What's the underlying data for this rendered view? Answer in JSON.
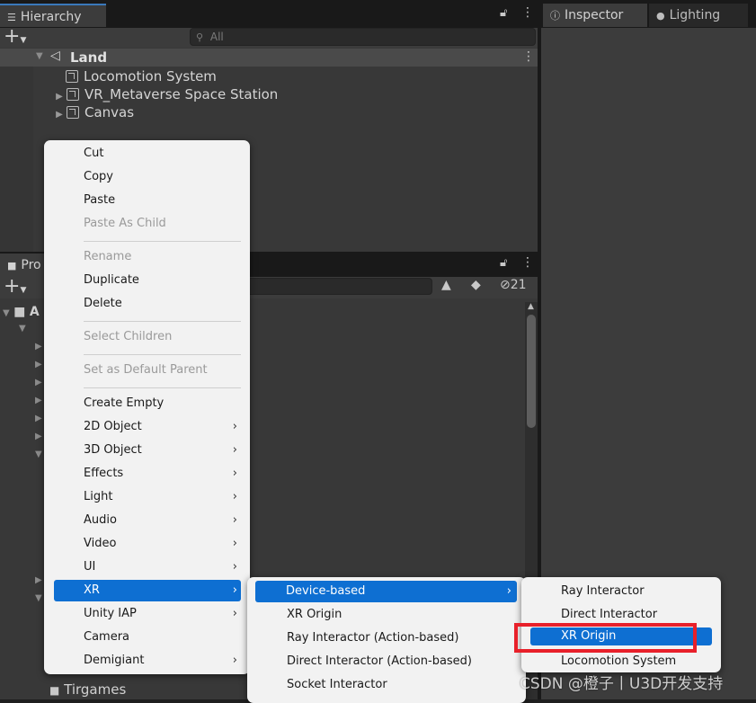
{
  "hierarchy": {
    "tab_label": "Hierarchy",
    "search_placeholder": "All",
    "scene_name": "Land",
    "items": [
      "Locomotion System",
      "VR_Metaverse Space Station",
      "Canvas"
    ]
  },
  "inspector": {
    "tab_label": "Inspector"
  },
  "lighting": {
    "tab_label": "Lighting"
  },
  "project": {
    "tab_label": "Pro",
    "visible_count": "21",
    "root_fragment": "A",
    "folder_item": "Tirgames"
  },
  "context_menu": {
    "items": [
      {
        "label": "Cut"
      },
      {
        "label": "Copy"
      },
      {
        "label": "Paste"
      },
      {
        "label": "Paste As Child"
      },
      {
        "label": "Rename"
      },
      {
        "label": "Duplicate"
      },
      {
        "label": "Delete"
      },
      {
        "label": "Select Children"
      },
      {
        "label": "Set as Default Parent"
      },
      {
        "label": "Create Empty"
      },
      {
        "label": "2D Object"
      },
      {
        "label": "3D Object"
      },
      {
        "label": "Effects"
      },
      {
        "label": "Light"
      },
      {
        "label": "Audio"
      },
      {
        "label": "Video"
      },
      {
        "label": "UI"
      },
      {
        "label": "XR"
      },
      {
        "label": "Unity IAP"
      },
      {
        "label": "Camera"
      },
      {
        "label": "Demigiant"
      }
    ],
    "submenu_arrow": "›"
  },
  "xr_menu": {
    "items": [
      {
        "label": "Device-based"
      },
      {
        "label": "XR Origin"
      },
      {
        "label": "Ray Interactor (Action-based)"
      },
      {
        "label": "Direct Interactor (Action-based)"
      },
      {
        "label": "Socket Interactor"
      }
    ]
  },
  "device_menu": {
    "items": [
      {
        "label": "Ray Interactor"
      },
      {
        "label": "Direct Interactor"
      },
      {
        "label": "XR Origin"
      },
      {
        "label": "Locomotion System"
      }
    ]
  },
  "watermark": "CSDN @橙子丨U3D开发支持",
  "colors": {
    "highlight": "#0e6fd2",
    "annotation": "#e8202a",
    "menu_bg": "#f2f2f2"
  }
}
